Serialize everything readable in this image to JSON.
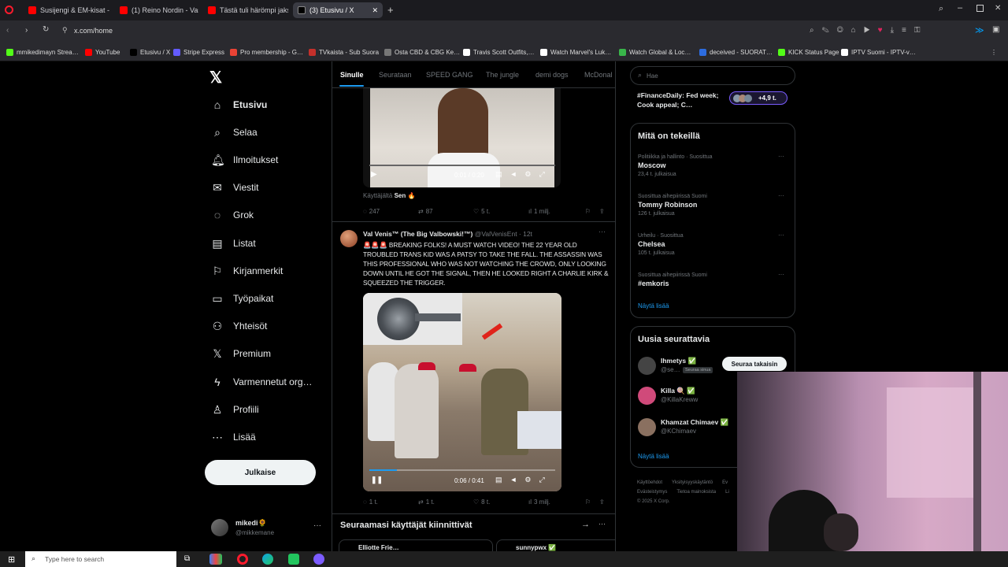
{
  "browser": {
    "tabs": [
      {
        "label": "Susijengi & EM-kisat - You",
        "color": "#ff0000",
        "active": false
      },
      {
        "label": "(1) Reino Nordin - Vasem",
        "color": "#ff0000",
        "active": false
      },
      {
        "label": "Tästä tuli härömpi jakso! F",
        "color": "#ff0000",
        "active": false
      },
      {
        "label": "(3) Etusivu / X",
        "color": "#000000",
        "active": true
      }
    ],
    "url": "x.com/home",
    "bookmarks": [
      {
        "label": "mmikedimayn Strea…",
        "color": "#53fc18"
      },
      {
        "label": "YouTube",
        "color": "#ff0000"
      },
      {
        "label": "Etusivu / X",
        "color": "#000000"
      },
      {
        "label": "Stripe Express",
        "color": "#635bff"
      },
      {
        "label": "Pro membership - G…",
        "color": "#ea4335"
      },
      {
        "label": "TVkaista - Sub Suora",
        "color": "#c4302b"
      },
      {
        "label": "Osta CBD & CBG Ke…",
        "color": "#777777"
      },
      {
        "label": "Travis Scott Outfits,…",
        "color": "#ffffff"
      },
      {
        "label": "Watch Marvel's Luk…",
        "color": "#ffffff"
      },
      {
        "label": "Watch Global & Loc…",
        "color": "#39b54a"
      },
      {
        "label": "deceived - SUORAT…",
        "color": "#2d6cdf"
      },
      {
        "label": "KICK Status Page",
        "color": "#53fc18"
      },
      {
        "label": "IPTV Suomi - IPTV-v…",
        "color": "#ffffff"
      }
    ]
  },
  "nav": {
    "items": [
      {
        "label": "Etusivu",
        "icon": "home-icon"
      },
      {
        "label": "Selaa",
        "icon": "search-icon"
      },
      {
        "label": "Ilmoitukset",
        "icon": "bell-icon"
      },
      {
        "label": "Viestit",
        "icon": "mail-icon"
      },
      {
        "label": "Grok",
        "icon": "grok-icon"
      },
      {
        "label": "Listat",
        "icon": "list-icon"
      },
      {
        "label": "Kirjanmerkit",
        "icon": "bookmark-icon"
      },
      {
        "label": "Työpaikat",
        "icon": "briefcase-icon"
      },
      {
        "label": "Yhteisöt",
        "icon": "people-icon"
      },
      {
        "label": "Premium",
        "icon": "x-icon"
      },
      {
        "label": "Varmennetut org…",
        "icon": "lightning-icon"
      },
      {
        "label": "Profiili",
        "icon": "person-icon"
      },
      {
        "label": "Lisää",
        "icon": "more-icon"
      }
    ],
    "post_button": "Julkaise",
    "account": {
      "name": "mikedi🌻",
      "handle": "@mikkemane"
    }
  },
  "feed": {
    "tabs": [
      "Sinulle",
      "Seurataan",
      "SPEED GANG",
      "The jungle",
      "demi dogs",
      "McDonal"
    ],
    "video1": {
      "time": "0:01 / 0:20",
      "caption": "Käyttäjältä",
      "caption_user": "Sen 🔥",
      "replies": "247",
      "reposts": "87",
      "likes": "5 t.",
      "views": "1 milj."
    },
    "tweet": {
      "name": "Val Venis™ (The Big Valbowski!™)",
      "handle": "@ValVenisEnt · 12t",
      "text": "🚨🚨🚨 BREAKING FOLKS! A MUST WATCH VIDEO! THE 22 YEAR OLD TROUBLED TRANS KID WAS A PATSY TO TAKE THE FALL. THE ASSASSIN WAS THIS PROFESSIONAL WHO WAS NOT WATCHING THE CROWD, ONLY LOOKING DOWN UNTIL HE GOT THE SIGNAL, THEN HE LOOKED RIGHT A CHARLIE KIRK & SQUEEZED THE TRIGGER.",
      "video_time": "0:06 / 0:41",
      "replies": "1 t.",
      "reposts": "1 t.",
      "likes": "8 t.",
      "views": "3 milj."
    },
    "pinned_header": "Seuraamasi käyttäjät kiinnittivät",
    "pinned_users": [
      "Elliotte Frie…",
      "sunnypwx ✅"
    ]
  },
  "right": {
    "search_placeholder": "Hae",
    "finance": {
      "text": "#FinanceDaily: Fed week; Cook appeal; C…",
      "extra": "+4,9 t."
    },
    "trends_title": "Mitä on tekeillä",
    "trends": [
      {
        "cat": "Politiikka ja hallinto · Suosittua",
        "name": "Moscow",
        "cnt": "23,4 t. julkaisua"
      },
      {
        "cat": "Suosittua aihepiirissä Suomi",
        "name": "Tommy Robinson",
        "cnt": "126 t. julkaisua"
      },
      {
        "cat": "Urheilu · Suosittua",
        "name": "Chelsea",
        "cnt": "105 t. julkaisua"
      },
      {
        "cat": "Suosittua aihepiirissä Suomi",
        "name": "#emkoris",
        "cnt": ""
      }
    ],
    "show_more": "Näytä lisää",
    "follow_title": "Uusia seurattavia",
    "follow": [
      {
        "name": "Ihmetys ✅",
        "handle": "@se…",
        "badge": "Seuraa sinua",
        "button": "Seuraa takaisin"
      },
      {
        "name": "Killa 🍭 ✅",
        "handle": "@KillaKreww"
      },
      {
        "name": "Khamzat Chimaev ✅",
        "handle": "@KChimaev"
      }
    ],
    "footer": [
      "Käyttöehdot",
      "Yksityisyyskäytäntö",
      "Ev",
      "Evästeistymys",
      "Tietoa mainoksista",
      "Li",
      "© 2025 X Corp."
    ]
  },
  "taskbar": {
    "search_placeholder": "Type here to search"
  }
}
